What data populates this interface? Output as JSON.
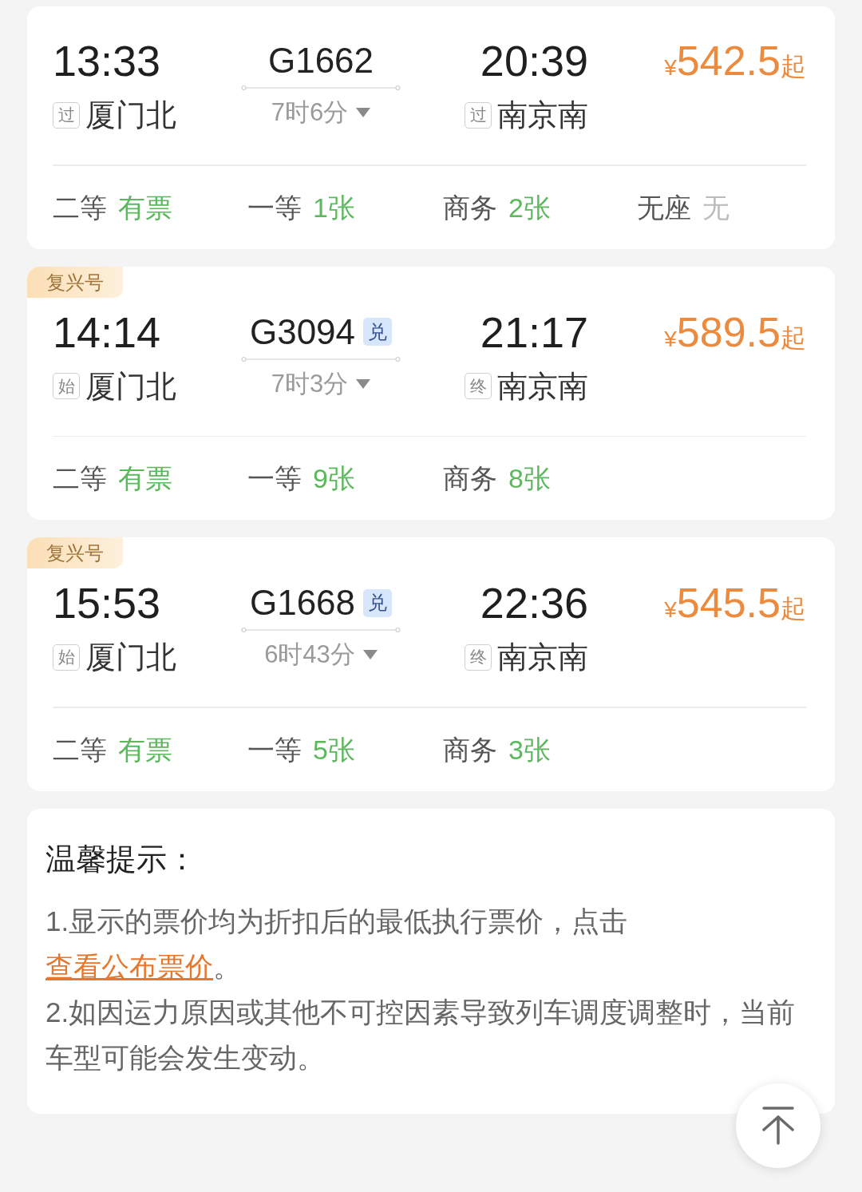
{
  "trains": [
    {
      "departure": {
        "time": "13:33",
        "tag": "过",
        "station": "厦门北"
      },
      "train_number": "G1662",
      "duration": "7时6分",
      "arrival": {
        "time": "20:39",
        "tag": "过",
        "station": "南京南"
      },
      "price": {
        "currency": "¥",
        "amount": "542.5",
        "suffix": "起"
      },
      "seats": [
        {
          "name": "二等",
          "availability": "有票",
          "available": true
        },
        {
          "name": "一等",
          "availability": "1张",
          "available": true
        },
        {
          "name": "商务",
          "availability": "2张",
          "available": true
        },
        {
          "name": "无座",
          "availability": "无",
          "available": false
        }
      ]
    },
    {
      "badge": "复兴号",
      "departure": {
        "time": "14:14",
        "tag": "始",
        "station": "厦门北"
      },
      "train_number": "G3094",
      "number_tag": "兑",
      "duration": "7时3分",
      "arrival": {
        "time": "21:17",
        "tag": "终",
        "station": "南京南"
      },
      "price": {
        "currency": "¥",
        "amount": "589.5",
        "suffix": "起"
      },
      "seats": [
        {
          "name": "二等",
          "availability": "有票",
          "available": true
        },
        {
          "name": "一等",
          "availability": "9张",
          "available": true
        },
        {
          "name": "商务",
          "availability": "8张",
          "available": true
        }
      ]
    },
    {
      "badge": "复兴号",
      "departure": {
        "time": "15:53",
        "tag": "始",
        "station": "厦门北"
      },
      "train_number": "G1668",
      "number_tag": "兑",
      "duration": "6时43分",
      "arrival": {
        "time": "22:36",
        "tag": "终",
        "station": "南京南"
      },
      "price": {
        "currency": "¥",
        "amount": "545.5",
        "suffix": "起"
      },
      "seats": [
        {
          "name": "二等",
          "availability": "有票",
          "available": true
        },
        {
          "name": "一等",
          "availability": "5张",
          "available": true
        },
        {
          "name": "商务",
          "availability": "3张",
          "available": true
        }
      ]
    }
  ],
  "notice": {
    "title": "温馨提示：",
    "items": [
      {
        "text": "1.显示的票价均为折扣后的最低执行票价，点击 ",
        "link": "查看公布票价",
        "text_after": "。"
      },
      {
        "text": "2.如因运力原因或其他不可控因素导致列车调度调整时，当前车型可能会发生变动。"
      }
    ]
  }
}
